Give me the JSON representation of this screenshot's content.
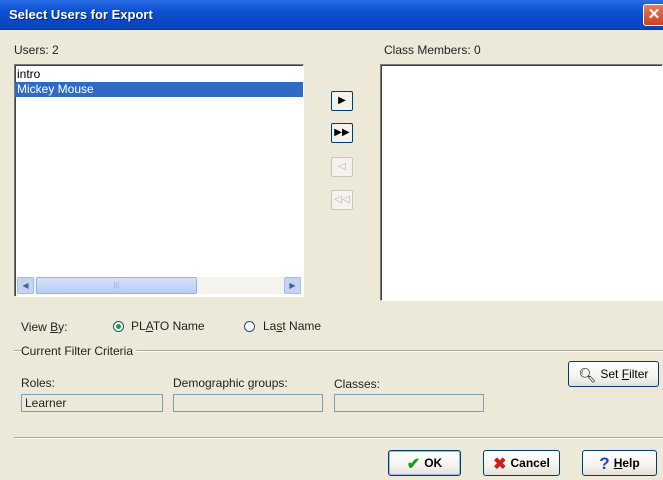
{
  "window": {
    "title": "Select Users for Export",
    "close_glyph": "✕"
  },
  "users": {
    "label": "Users: 2",
    "items": [
      "intro",
      "Mickey Mouse"
    ],
    "selected_index": 1
  },
  "class_members": {
    "label": "Class Members: 0",
    "items": []
  },
  "move_buttons": [
    {
      "icon": "arrow-right-icon",
      "glyph": "▶",
      "enabled": true
    },
    {
      "icon": "double-arrow-right-icon",
      "glyph": "▶▶",
      "enabled": true
    },
    {
      "icon": "arrow-left-icon",
      "glyph": "◁",
      "enabled": false
    },
    {
      "icon": "double-arrow-left-icon",
      "glyph": "◁◁",
      "enabled": false
    }
  ],
  "scrollbar": {
    "left_glyph": "◀",
    "right_glyph": "▶",
    "grip": "|||"
  },
  "view_by": {
    "label_pre": "View ",
    "label_key": "B",
    "label_post": "y:",
    "opt1_pre": "PL",
    "opt1_key": "A",
    "opt1_post": "TO Name",
    "opt2_pre": "La",
    "opt2_key": "s",
    "opt2_post": "t Name",
    "selected": "PLATO Name"
  },
  "filter": {
    "group_label": "Current Filter Criteria",
    "roles_label": "Roles:",
    "roles_value": "Learner",
    "demographic_label": "Demographic groups:",
    "demographic_value": "",
    "classes_label": "Classes:",
    "classes_value": "",
    "set_filter_pre": "Set ",
    "set_filter_key": "F",
    "set_filter_post": "ilter"
  },
  "footer": {
    "ok_label": "OK",
    "cancel_label": "Cancel",
    "help_key": "H",
    "help_post": "elp"
  },
  "colors": {
    "selection": "#316ac5",
    "ok_check": "#1a9a1a",
    "cancel_x": "#c8201a",
    "help_q": "#1a46c8"
  }
}
